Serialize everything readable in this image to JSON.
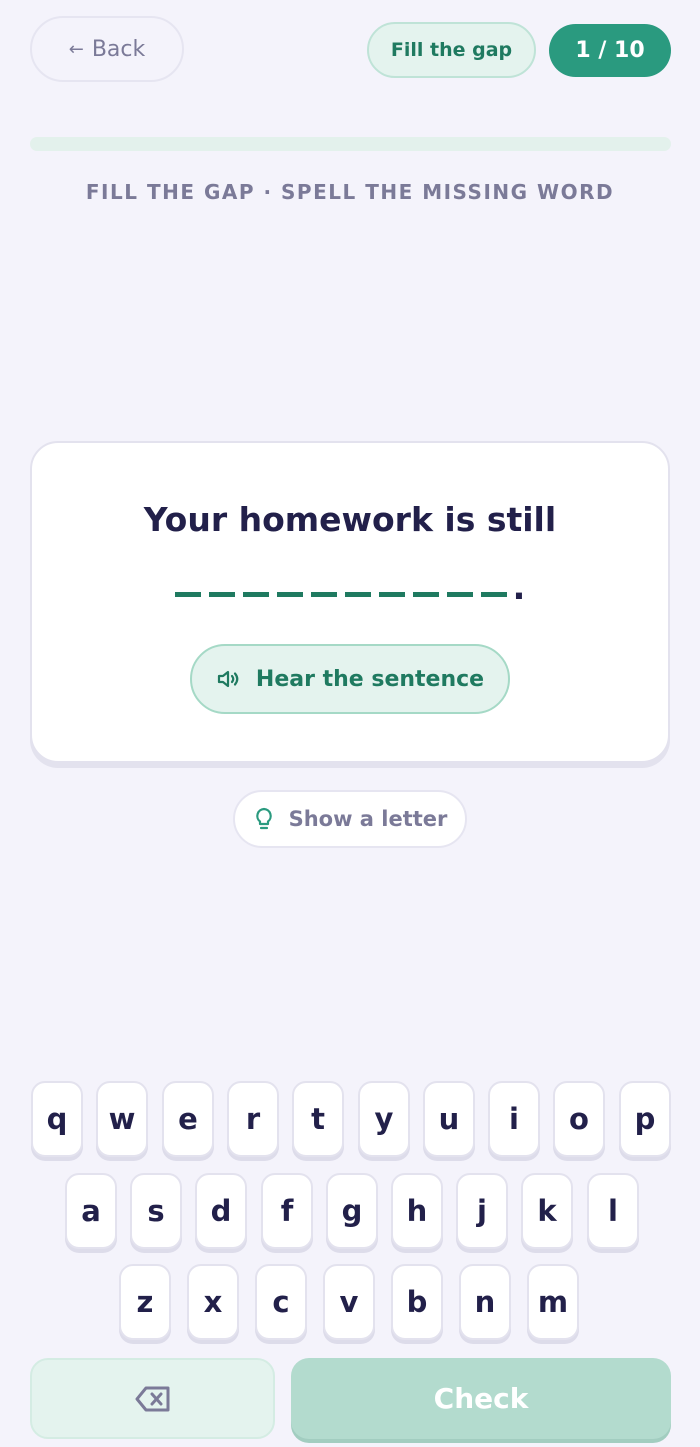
{
  "header": {
    "back_arrow": "←",
    "back_label": "Back",
    "mode_label": "Fill the gap",
    "counter": "1 / 10",
    "progress_fraction": 0.0
  },
  "instruction": "FILL THE GAP · SPELL THE MISSING WORD",
  "card": {
    "sentence": "Your homework is still",
    "gap_letters": 10,
    "gap_suffix": ".",
    "hear_label": "Hear the sentence",
    "hear_icon": "speaker-icon"
  },
  "hint": {
    "label": "Show a letter",
    "icon": "lightbulb-icon"
  },
  "keyboard": {
    "row1": [
      "q",
      "w",
      "e",
      "r",
      "t",
      "y",
      "u",
      "i",
      "o",
      "p"
    ],
    "row2": [
      "a",
      "s",
      "d",
      "f",
      "g",
      "h",
      "j",
      "k",
      "l"
    ],
    "row3": [
      "z",
      "x",
      "c",
      "v",
      "b",
      "n",
      "m"
    ],
    "backspace_icon": "backspace-icon",
    "check_label": "Check"
  },
  "colors": {
    "accent": "#2a9a7f",
    "accent_light": "#e4f3ee",
    "text_dark": "#22204a",
    "text_muted": "#7b7a98",
    "background": "#f4f3fb"
  }
}
